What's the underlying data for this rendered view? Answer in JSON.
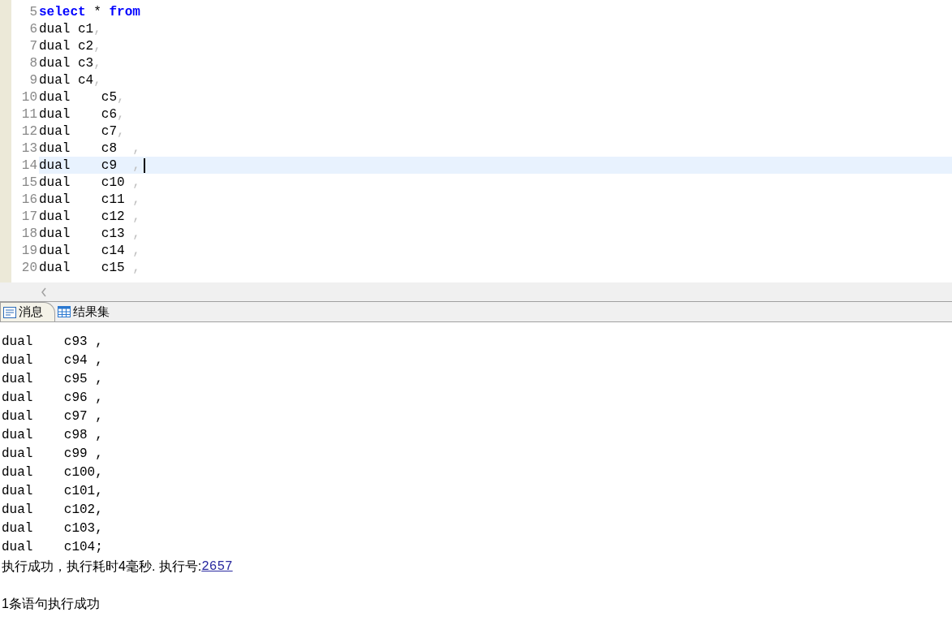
{
  "editor": {
    "lines": [
      {
        "number": "5",
        "current": false,
        "tokens": [
          {
            "kind": "keyword",
            "text": "select"
          },
          {
            "kind": "plain",
            "text": " * "
          },
          {
            "kind": "keyword",
            "text": "from"
          }
        ]
      },
      {
        "number": "6",
        "current": false,
        "tokens": [
          {
            "kind": "plain",
            "text": "dual c1"
          },
          {
            "kind": "punct",
            "text": ","
          }
        ]
      },
      {
        "number": "7",
        "current": false,
        "tokens": [
          {
            "kind": "plain",
            "text": "dual c2"
          },
          {
            "kind": "punct",
            "text": ","
          }
        ]
      },
      {
        "number": "8",
        "current": false,
        "tokens": [
          {
            "kind": "plain",
            "text": "dual c3"
          },
          {
            "kind": "punct",
            "text": ","
          }
        ]
      },
      {
        "number": "9",
        "current": false,
        "tokens": [
          {
            "kind": "plain",
            "text": "dual c4"
          },
          {
            "kind": "punct",
            "text": ","
          }
        ]
      },
      {
        "number": "10",
        "current": false,
        "tokens": [
          {
            "kind": "plain",
            "text": "dual    c5"
          },
          {
            "kind": "punct",
            "text": ","
          }
        ]
      },
      {
        "number": "11",
        "current": false,
        "tokens": [
          {
            "kind": "plain",
            "text": "dual    c6"
          },
          {
            "kind": "punct",
            "text": ","
          }
        ]
      },
      {
        "number": "12",
        "current": false,
        "tokens": [
          {
            "kind": "plain",
            "text": "dual    c7"
          },
          {
            "kind": "punct",
            "text": ","
          }
        ]
      },
      {
        "number": "13",
        "current": false,
        "tokens": [
          {
            "kind": "plain",
            "text": "dual    c8  "
          },
          {
            "kind": "punct",
            "text": ","
          }
        ]
      },
      {
        "number": "14",
        "current": true,
        "tokens": [
          {
            "kind": "plain",
            "text": "dual    c9  "
          },
          {
            "kind": "punct",
            "text": ","
          }
        ]
      },
      {
        "number": "15",
        "current": false,
        "tokens": [
          {
            "kind": "plain",
            "text": "dual    c10 "
          },
          {
            "kind": "punct",
            "text": ","
          }
        ]
      },
      {
        "number": "16",
        "current": false,
        "tokens": [
          {
            "kind": "plain",
            "text": "dual    c11 "
          },
          {
            "kind": "punct",
            "text": ","
          }
        ]
      },
      {
        "number": "17",
        "current": false,
        "tokens": [
          {
            "kind": "plain",
            "text": "dual    c12 "
          },
          {
            "kind": "punct",
            "text": ","
          }
        ]
      },
      {
        "number": "18",
        "current": false,
        "tokens": [
          {
            "kind": "plain",
            "text": "dual    c13 "
          },
          {
            "kind": "punct",
            "text": ","
          }
        ]
      },
      {
        "number": "19",
        "current": false,
        "tokens": [
          {
            "kind": "plain",
            "text": "dual    c14 "
          },
          {
            "kind": "punct",
            "text": ","
          }
        ]
      },
      {
        "number": "20",
        "current": false,
        "tokens": [
          {
            "kind": "plain",
            "text": "dual    c15 "
          },
          {
            "kind": "punct",
            "text": ","
          }
        ]
      }
    ]
  },
  "tabs": [
    {
      "label": "消息",
      "selected": true,
      "kind": "message"
    },
    {
      "label": "结果集",
      "selected": false,
      "kind": "grid"
    }
  ],
  "output": {
    "lines": [
      "dual    c93 ,",
      "dual    c94 ,",
      "dual    c95 ,",
      "dual    c96 ,",
      "dual    c97 ,",
      "dual    c98 ,",
      "dual    c99 ,",
      "dual    c100,",
      "dual    c101,",
      "dual    c102,",
      "dual    c103,",
      "dual    c104;"
    ],
    "status": {
      "text": "执行成功，执行耗时4毫秒. 执行号:",
      "link": "2657"
    },
    "summary": "1条语句执行成功"
  }
}
